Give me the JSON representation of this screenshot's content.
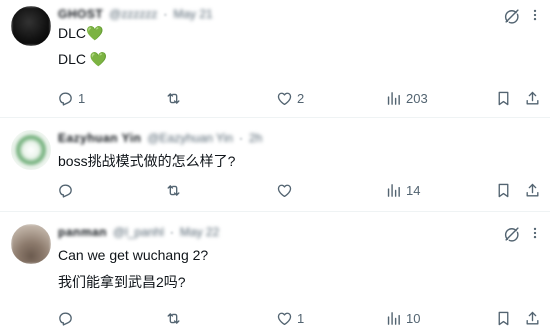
{
  "tweets": [
    {
      "name": "GHOST",
      "handle": "@zzzzzz",
      "date": "May 21",
      "lines": [
        "DLC💚",
        "DLC 💚"
      ],
      "replies": "1",
      "retweets": "",
      "likes": "2",
      "views": "203"
    },
    {
      "name": "Eazyhuan Yin",
      "handle": "@Eazyhuan Yin",
      "date": "2h",
      "lines": [
        "boss挑战模式做的怎么样了?"
      ],
      "replies": "",
      "retweets": "",
      "likes": "",
      "views": "14"
    },
    {
      "name": "panman",
      "handle": "@l_panhl",
      "date": "May 22",
      "lines": [
        "Can we get wuchang 2?",
        "我们能拿到武昌2吗?"
      ],
      "replies": "",
      "retweets": "",
      "likes": "1",
      "views": "10"
    }
  ],
  "colors": {
    "text": "#0f1419",
    "muted": "#536471",
    "border": "#eff3f4",
    "heart_emoji": "#3fa34d"
  },
  "icons": {
    "reply": "reply-icon",
    "retweet": "retweet-icon",
    "like": "heart-icon",
    "views": "views-icon",
    "bookmark": "bookmark-icon",
    "share": "share-icon",
    "grok": "grok-icon",
    "more": "more-icon"
  }
}
